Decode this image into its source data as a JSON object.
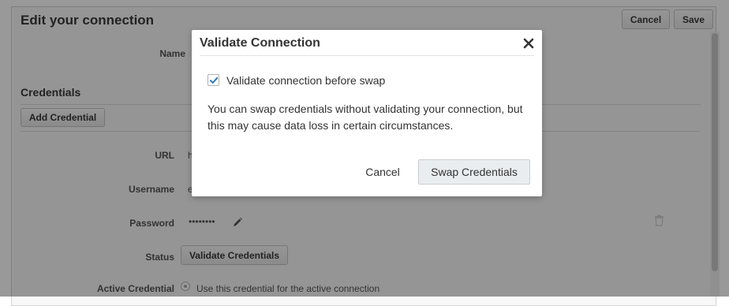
{
  "page": {
    "title": "Edit your connection",
    "cancel_label": "Cancel",
    "save_label": "Save"
  },
  "form": {
    "name_label": "Name",
    "credentials_heading": "Credentials",
    "add_credential_label": "Add Credential",
    "url_label": "URL",
    "url_value": "h",
    "username_label": "Username",
    "username_value": "e",
    "password_label": "Password",
    "password_value": "••••••••",
    "status_label": "Status",
    "validate_credentials_label": "Validate Credentials",
    "active_credential_label": "Active Credential",
    "active_credential_option": "Use this credential for the active connection"
  },
  "modal": {
    "title": "Validate Connection",
    "checkbox_label": "Validate connection before swap",
    "checkbox_checked": true,
    "body": "You can swap credentials without validating your connection, but this may cause data loss in certain circumstances.",
    "cancel_label": "Cancel",
    "swap_label": "Swap Credentials"
  },
  "colors": {
    "check_accent": "#2b7bc2",
    "overlay": "#000000"
  },
  "icons": {
    "close": "close-icon",
    "check": "check-icon",
    "pencil": "pencil-icon",
    "trash": "trash-icon"
  }
}
